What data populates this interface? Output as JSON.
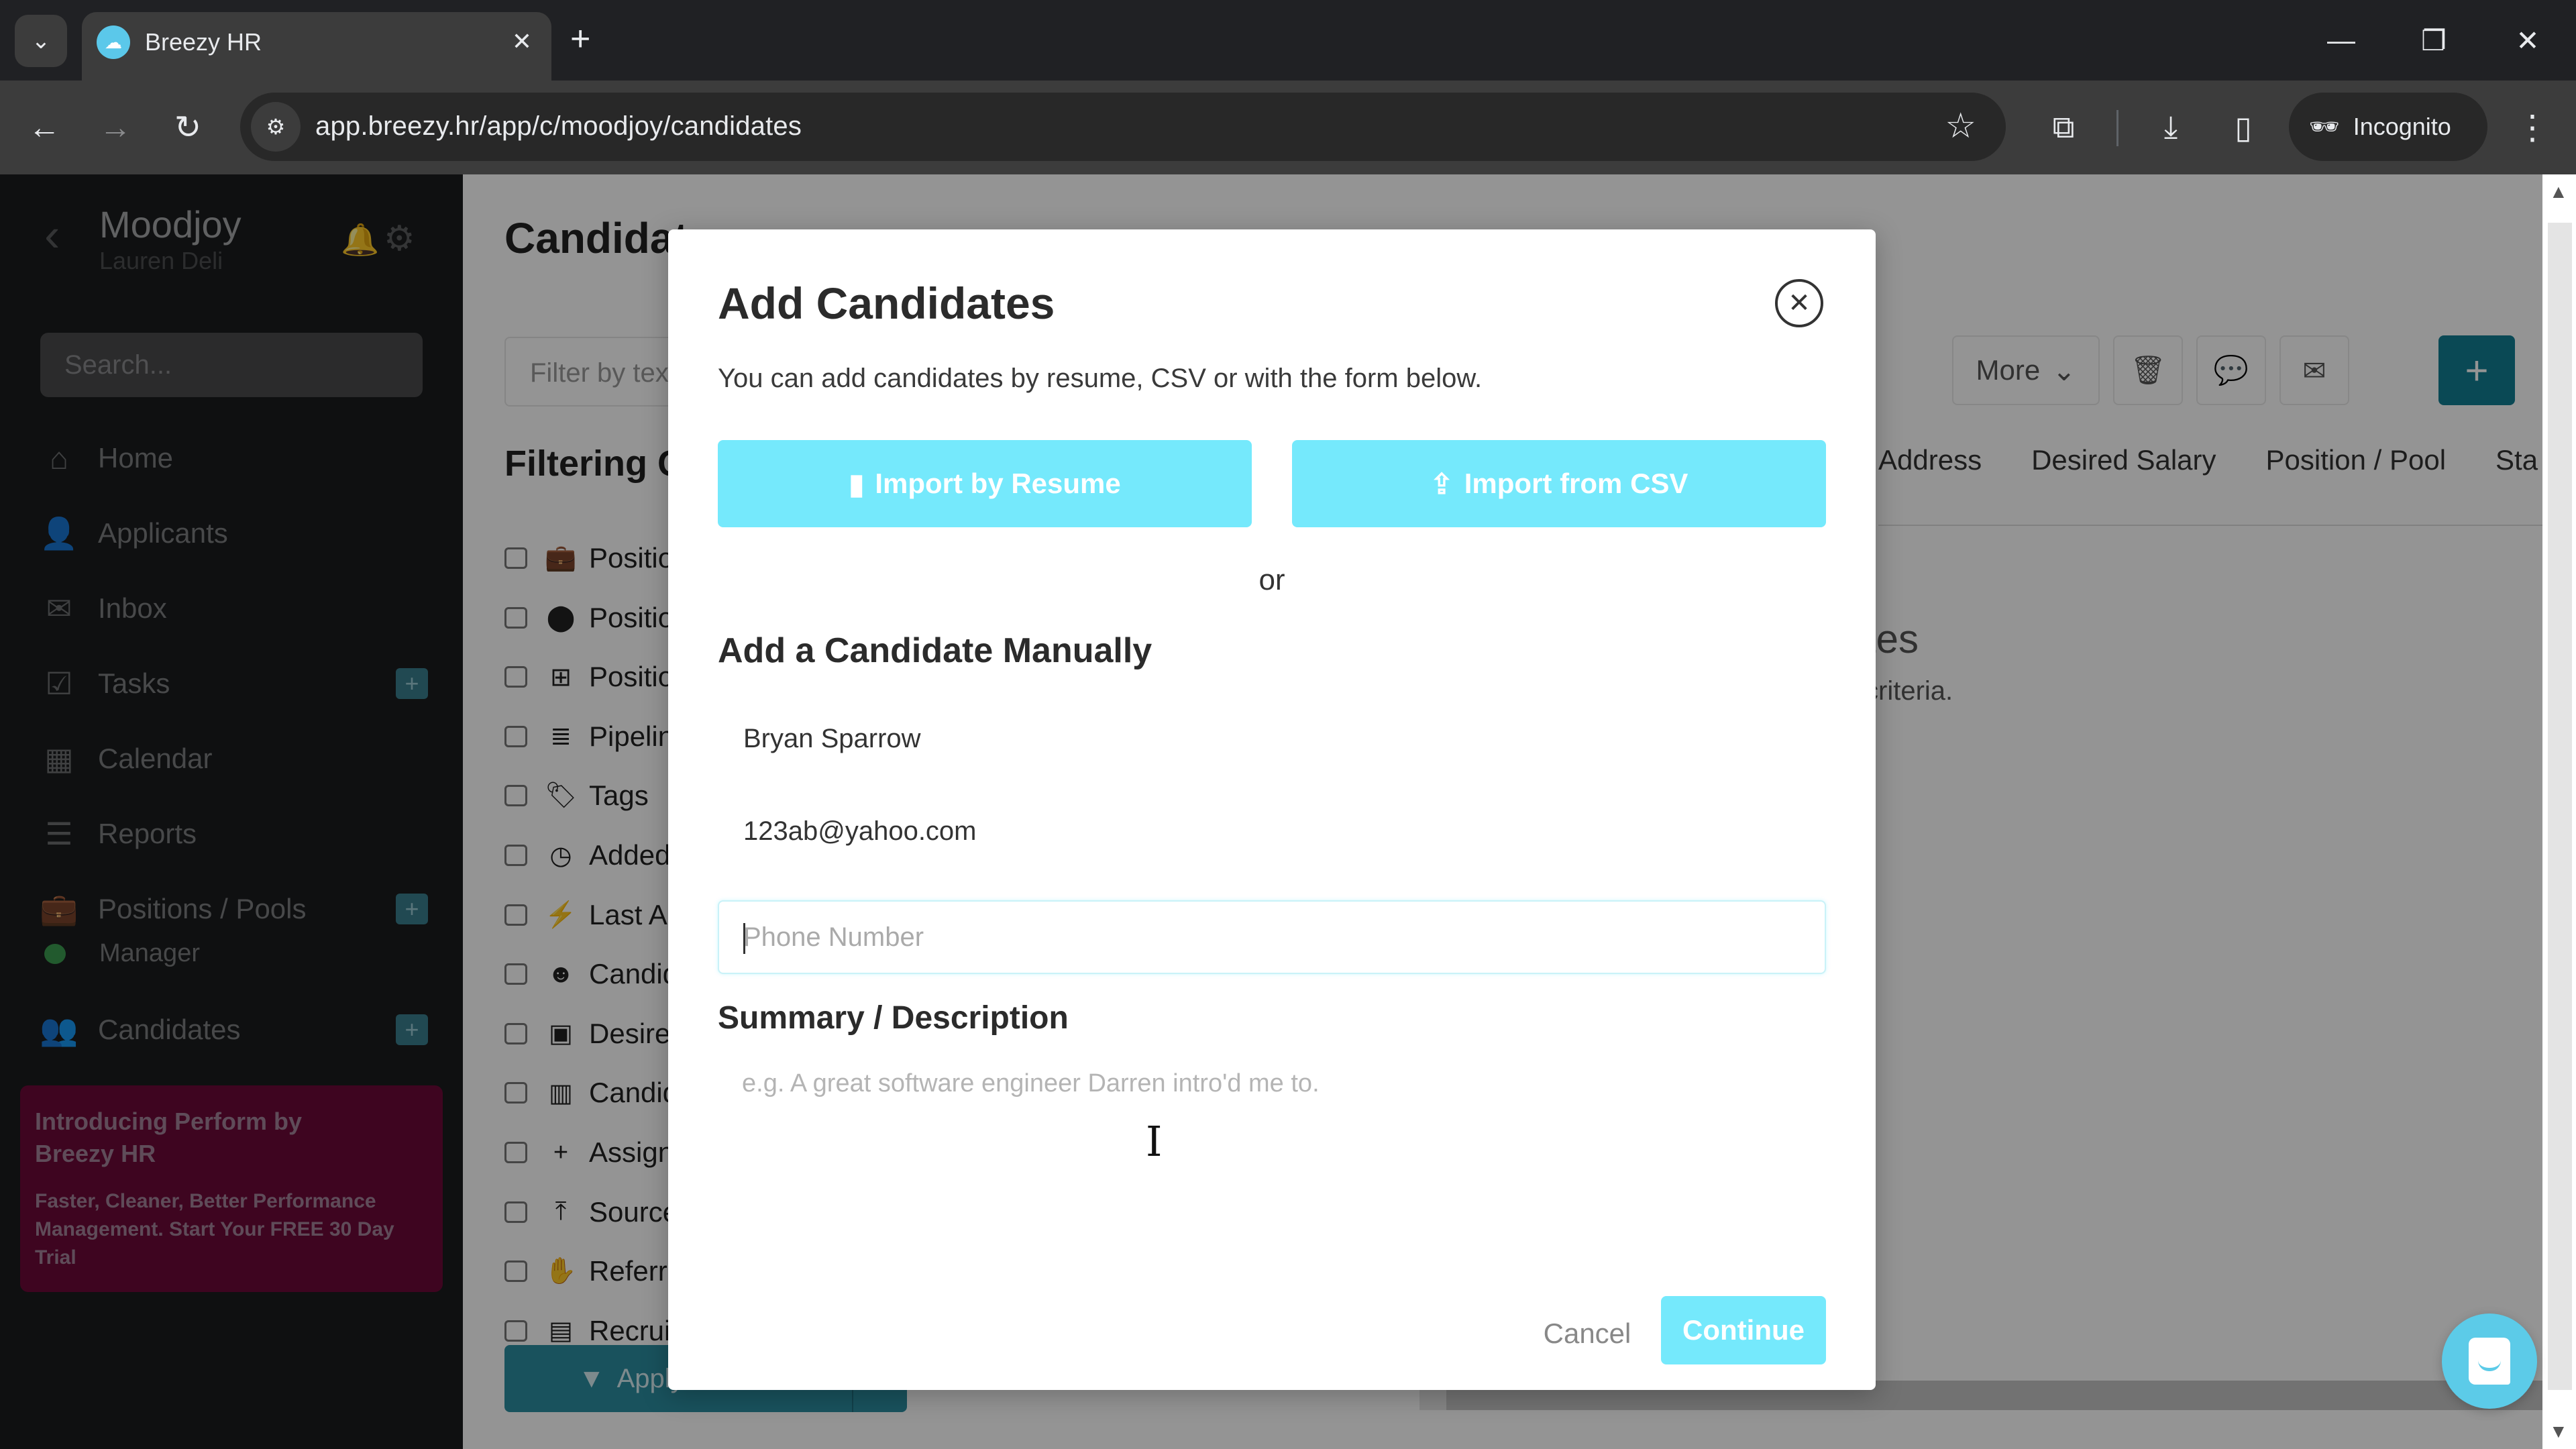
{
  "browser": {
    "tab_title": "Breezy HR",
    "url": "app.breezy.hr/app/c/moodjoy/candidates",
    "profile_label": "Incognito",
    "icons": {
      "tab_search": "chevron-down-icon",
      "favicon": "breezy-cloud-icon",
      "tab_close": "close-icon",
      "new_tab": "plus-icon",
      "minimize": "minimize-icon",
      "restore": "restore-icon",
      "close_window": "close-icon",
      "back": "arrow-left-icon",
      "forward": "arrow-right-icon",
      "reload": "reload-icon",
      "site_info": "tune-icon",
      "bookmark": "star-icon",
      "extensions": "puzzle-icon",
      "downloads": "download-icon",
      "side_panel": "side-panel-icon",
      "incognito": "incognito-icon",
      "menu": "kebab-menu-icon"
    }
  },
  "sidebar": {
    "company": "Moodjoy",
    "user": "Lauren Deli",
    "search_placeholder": "Search...",
    "items": [
      {
        "label": "Home",
        "icon": "home-icon",
        "has_add": false
      },
      {
        "label": "Applicants",
        "icon": "user-icon",
        "has_add": false
      },
      {
        "label": "Inbox",
        "icon": "envelope-icon",
        "has_add": false
      },
      {
        "label": "Tasks",
        "icon": "checkbox-icon",
        "has_add": true
      },
      {
        "label": "Calendar",
        "icon": "calendar-icon",
        "has_add": false
      },
      {
        "label": "Reports",
        "icon": "bar-chart-icon",
        "has_add": false
      },
      {
        "label": "Positions / Pools",
        "icon": "briefcase-icon",
        "has_add": true
      },
      {
        "label": "Candidates",
        "icon": "users-icon",
        "has_add": true
      }
    ],
    "sub_item": {
      "label": "Manager",
      "status_color": "#3c9b50"
    },
    "promo": {
      "title": "Introducing Perform by Breezy HR",
      "body": "Faster, Cleaner, Better Performance Management. Start Your FREE 30 Day Trial",
      "bg_color": "#6c0a38"
    }
  },
  "main": {
    "page_title": "Candidates",
    "filter_placeholder": "Filter by text",
    "filtering_title": "Filtering Criteria",
    "criteria": [
      {
        "label": "Position",
        "icon": "briefcase-icon"
      },
      {
        "label": "Position Location",
        "icon": "map-pin-icon"
      },
      {
        "label": "Position Department",
        "icon": "grid-icon"
      },
      {
        "label": "Pipeline Stage",
        "icon": "ordered-list-icon"
      },
      {
        "label": "Tags",
        "icon": "tag-icon"
      },
      {
        "label": "Added Date",
        "icon": "clock-icon"
      },
      {
        "label": "Last Activity",
        "icon": "bolt-icon"
      },
      {
        "label": "Candidate",
        "icon": "user-circle-icon"
      },
      {
        "label": "Desired Salary",
        "icon": "money-icon"
      },
      {
        "label": "Candidate Address",
        "icon": "map-icon"
      },
      {
        "label": "Assigned",
        "icon": "user-plus-icon"
      },
      {
        "label": "Source",
        "icon": "upload-icon"
      },
      {
        "label": "Referrer",
        "icon": "handshake-icon"
      },
      {
        "label": "Recruiter",
        "icon": "id-card-icon"
      }
    ],
    "apply_label": "Apply",
    "more_label": "More",
    "columns": [
      "Address",
      "Desired Salary",
      "Position / Pool",
      "Sta"
    ],
    "empty_title": "tes",
    "empty_subtitle": "criteria."
  },
  "modal": {
    "title": "Add Candidates",
    "description": "You can add candidates by resume, CSV or with the form below.",
    "import_resume_label": "Import by Resume",
    "import_csv_label": "Import from CSV",
    "or_label": "or",
    "manual_title": "Add a Candidate Manually",
    "name_value": "Bryan Sparrow",
    "email_value": "123ab@yahoo.com",
    "phone_value": "",
    "phone_placeholder": "Phone Number",
    "summary_title": "Summary / Description",
    "summary_placeholder": "e.g. A great software engineer Darren intro'd me to.",
    "cancel_label": "Cancel",
    "continue_label": "Continue",
    "accent_color": "#75e9fc"
  }
}
